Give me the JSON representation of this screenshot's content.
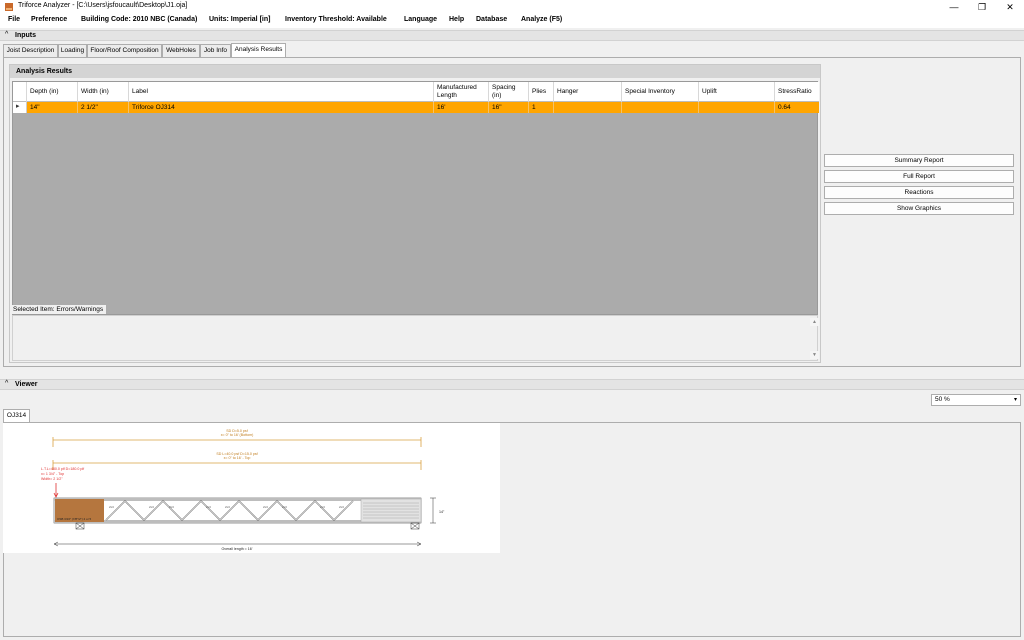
{
  "app": {
    "title": "Triforce Analyzer  - [C:\\Users\\jsfoucault\\Desktop\\J1.oja]",
    "window_buttons": [
      "—",
      "❐",
      "✕"
    ]
  },
  "menu": [
    "File",
    "Preference",
    "Building Code:  2010 NBC (Canada)",
    "Units: Imperial [in]",
    "Inventory Threshold:  Available",
    "Language",
    "Help",
    "Database",
    "Analyze (F5)"
  ],
  "inputs_section": {
    "title": "Inputs",
    "chevron": "^"
  },
  "tabs": [
    "Joist Description",
    "Loading",
    "Floor/Roof Composition",
    "WebHoles",
    "Job Info",
    "Analysis Results"
  ],
  "active_tab": "Analysis Results",
  "analysis": {
    "title": "Analysis Results",
    "columns": [
      "Depth (in)",
      "Width (in)",
      "Label",
      "Manufactured Length",
      "Spacing (in)",
      "Plies",
      "Hanger",
      "Special Inventory",
      "Uplift",
      "StressRatio"
    ],
    "rows": [
      {
        "depth": "14\"",
        "width": "2 1/2\"",
        "label": "Triforce OJ314",
        "length": "16'",
        "spacing": "16\"",
        "plies": "1",
        "hanger": "",
        "special_inventory": "",
        "uplift": "",
        "stress_ratio": "0.64"
      }
    ],
    "row_marker": "▸",
    "selected_item_label": "Selected Item: Errors/Warnings",
    "scroll_up": "▲",
    "scroll_down": "▼"
  },
  "side_buttons": [
    "Summary Report",
    "Full Report",
    "Reactions",
    "Show Graphics"
  ],
  "viewer_section": {
    "title": "Viewer",
    "chevron": "^"
  },
  "viewer": {
    "zoom": "50 %",
    "zoom_dd": "▾",
    "tab": "OJ314"
  },
  "drawing": {
    "dead_load": "SD D=5.0 psf",
    "dead_range": "x= 0\" to 16' (Bottom)",
    "live_load": "SD L=40.0 psf D=15.0 psf",
    "live_range": "x= 0\" to 16' - Top",
    "point_load_1": "L.T.L=480.0 plf D=180.0 plf",
    "point_load_2": "x= 1 3/4\" - Top",
    "point_load_3": "Width= 2 1/2\"",
    "depth": "14\"",
    "overall": "Overall length = 16'",
    "web_labels": [
      "2x3",
      "2x3",
      "2x3",
      "2x3",
      "2x3",
      "2x3",
      "2x3",
      "2x3",
      "2x3"
    ],
    "chord_label": "OSB 3/16\" (7/8\"/2\")  4 or 5"
  },
  "colors": {
    "selected_row": "#ffa500",
    "grid_bg": "#ababab",
    "load_line": "#d9a040",
    "point_load": "#e03030"
  }
}
